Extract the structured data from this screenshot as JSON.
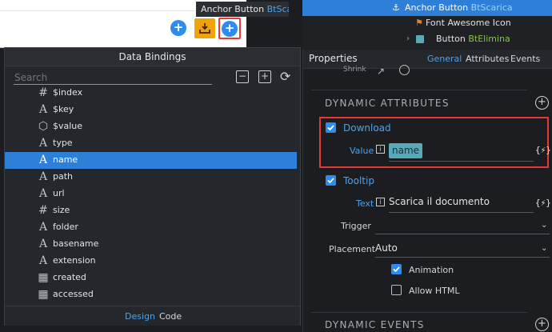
{
  "tooltip": {
    "prefix": "Anchor Button",
    "class_name": "BtScaric"
  },
  "structure": {
    "selected": {
      "label": "Anchor Button",
      "class_name": "BtScarica"
    },
    "child1": {
      "label": "Font Awesome Icon"
    },
    "child2": {
      "label": "Button",
      "class_name": "BtElimina"
    }
  },
  "properties": {
    "title": "Properties",
    "tabs": [
      "General",
      "Attributes",
      "Events"
    ],
    "shrink_label": "Shrink",
    "dynamic_attributes_header": "DYNAMIC ATTRIBUTES",
    "download": {
      "label": "Download",
      "value_label": "Value",
      "binding": "name"
    },
    "tooltip": {
      "label": "Tooltip",
      "text_label": "Text",
      "text_value": "Scarica il documento"
    },
    "trigger_label": "Trigger",
    "placement_label": "Placement",
    "placement_value": "Auto",
    "animation_label": "Animation",
    "allow_html_label": "Allow HTML",
    "dynamic_events_header": "DYNAMIC EVENTS",
    "bind_icon": "{⚡}"
  },
  "dialog": {
    "title": "Data Bindings",
    "search_placeholder": "Search",
    "items": [
      {
        "label": "$index",
        "icon": "hash"
      },
      {
        "label": "$key",
        "icon": "text"
      },
      {
        "label": "$value",
        "icon": "cube"
      },
      {
        "label": "type",
        "icon": "text"
      },
      {
        "label": "name",
        "icon": "text"
      },
      {
        "label": "path",
        "icon": "text"
      },
      {
        "label": "url",
        "icon": "text"
      },
      {
        "label": "size",
        "icon": "hash"
      },
      {
        "label": "folder",
        "icon": "text"
      },
      {
        "label": "basename",
        "icon": "text"
      },
      {
        "label": "extension",
        "icon": "text"
      },
      {
        "label": "created",
        "icon": "calendar"
      },
      {
        "label": "accessed",
        "icon": "calendar"
      }
    ],
    "footer_tabs": [
      "Design",
      "Code"
    ]
  },
  "colors": {
    "accent": "#2d8cf0",
    "selection": "#2d7fd7",
    "highlight": "#e53935",
    "download_button": "#f0a20a"
  }
}
